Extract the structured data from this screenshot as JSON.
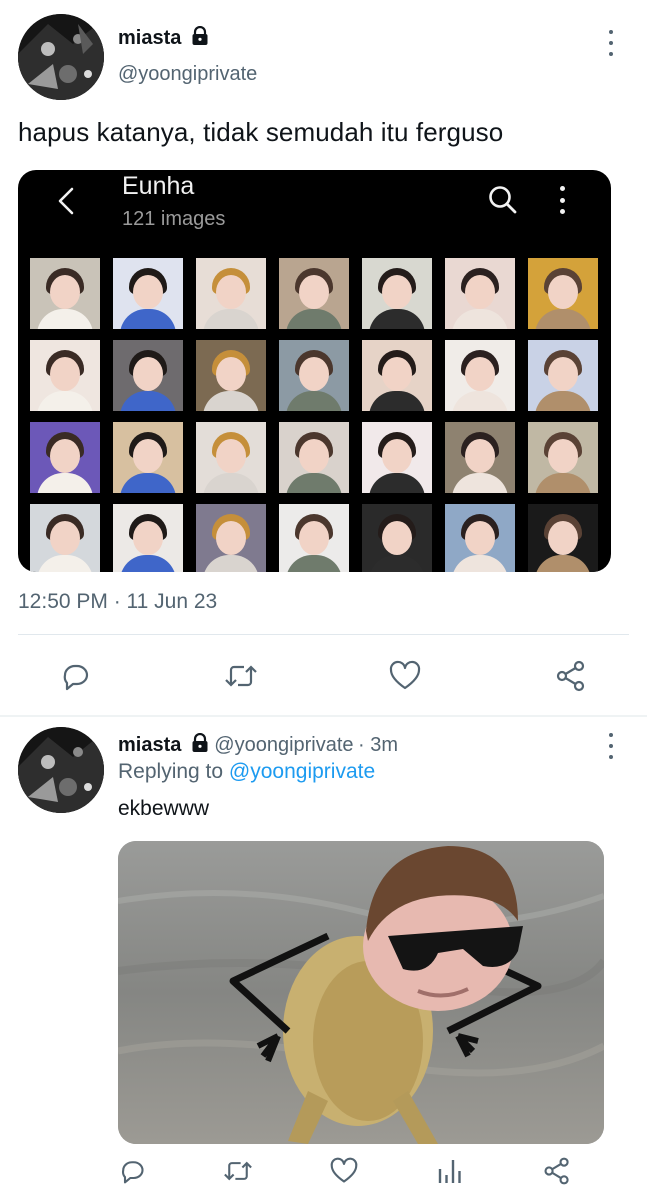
{
  "main_tweet": {
    "display_name": "miasta",
    "handle": "@yoongiprivate",
    "text": "hapus katanya, tidak semudah itu ferguso",
    "timestamp": "12:50 PM · 11 Jun 23",
    "lock_icon": "lock-icon",
    "more_icon": "more-vertical-icon",
    "embedded_screenshot": {
      "album_title": "Eunha",
      "album_count": "121 images",
      "back_icon": "chevron-left-icon",
      "search_icon": "search-icon",
      "menu_icon": "more-vertical-icon"
    },
    "actions": [
      "reply-icon",
      "retweet-icon",
      "like-icon",
      "share-icon"
    ]
  },
  "reply_tweet": {
    "display_name": "miasta",
    "handle": "@yoongiprivate",
    "time_ago": "· 3m",
    "replying_prefix": "Replying to",
    "replying_to": "@yoongiprivate",
    "text": "ekbewww",
    "actions": [
      "reply-icon",
      "retweet-icon",
      "like-icon",
      "analytics-icon",
      "share-icon"
    ]
  },
  "colors": {
    "text": "#0f1419",
    "secondary": "#536471",
    "link": "#1d9bf0",
    "divider": "#e1e8ed"
  }
}
